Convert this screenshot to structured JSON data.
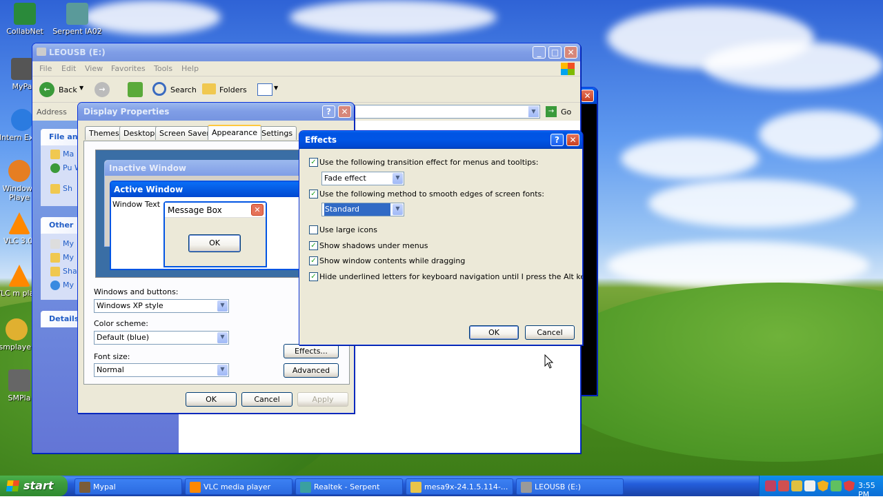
{
  "desktop_icons": [
    {
      "label": "CollabNet",
      "color": "#2a8a3a"
    },
    {
      "label": "Serpent IA02",
      "color": "#5a9a9a"
    },
    {
      "label": "MyPa",
      "color": "#555"
    },
    {
      "label": "Intern Explo",
      "color": "#2b7be0"
    },
    {
      "label": "Windows Playe",
      "color": "#e67e22"
    },
    {
      "label": "VLC 3.0.",
      "color": "#ff8800"
    },
    {
      "label": "VLC m playe",
      "color": "#ff8800"
    },
    {
      "label": "smplayer",
      "color": "#e0b030"
    },
    {
      "label": "SMPla",
      "color": "#666"
    }
  ],
  "explorer": {
    "title": "LEOUSB (E:)",
    "menu": [
      "File",
      "Edit",
      "View",
      "Favorites",
      "Tools",
      "Help"
    ],
    "toolbar": {
      "back": "Back",
      "search": "Search",
      "folders": "Folders"
    },
    "address_label": "Address",
    "go_label": "Go",
    "side": {
      "file_tasks": "File an",
      "file_items": [
        "Ma",
        "Pu We",
        "Sh"
      ],
      "other": "Other",
      "other_items": [
        "My",
        "My",
        "Sha",
        "My"
      ],
      "details": "Details"
    }
  },
  "display_props": {
    "title": "Display Properties",
    "tabs": [
      "Themes",
      "Desktop",
      "Screen Saver",
      "Appearance",
      "Settings"
    ],
    "selected_tab": "Appearance",
    "preview": {
      "inactive_title": "Inactive Window",
      "active_title": "Active Window",
      "window_text": "Window Text",
      "msgbox_title": "Message Box",
      "msgbox_ok": "OK"
    },
    "windows_buttons_label": "Windows and buttons:",
    "windows_buttons_value": "Windows XP style",
    "color_scheme_label": "Color scheme:",
    "color_scheme_value": "Default (blue)",
    "font_size_label": "Font size:",
    "font_size_value": "Normal",
    "effects_btn": "Effects...",
    "advanced_btn": "Advanced",
    "ok": "OK",
    "cancel": "Cancel",
    "apply": "Apply"
  },
  "effects": {
    "title": "Effects",
    "opt1": "Use the following transition effect for menus and tooltips:",
    "opt1_checked": true,
    "opt1_value": "Fade effect",
    "opt2": "Use the following method to smooth edges of screen fonts:",
    "opt2_checked": true,
    "opt2_value": "Standard",
    "opt3": "Use large icons",
    "opt3_checked": false,
    "opt4": "Show shadows under menus",
    "opt4_checked": true,
    "opt5": "Show window contents while dragging",
    "opt5_checked": true,
    "opt6": "Hide underlined letters for keyboard navigation until I press the Alt key",
    "opt6_checked": true,
    "ok": "OK",
    "cancel": "Cancel"
  },
  "taskbar": {
    "start": "start",
    "buttons": [
      {
        "label": "Mypal",
        "color": "#7a5c3a"
      },
      {
        "label": "VLC media player",
        "color": "#ff8800"
      },
      {
        "label": "Realtek - Serpent",
        "color": "#3aa0a0"
      },
      {
        "label": "mesa9x-24.1.5.114-...",
        "color": "#e8c44a"
      },
      {
        "label": "LEOUSB (E:)",
        "color": "#9a9a9a"
      }
    ],
    "clock": "3:55 PM"
  },
  "colors": {
    "xp_blue": "#0054e3",
    "taskbar": "#245edb",
    "start_green": "#3c9a3c",
    "tray": "#0f8ded"
  }
}
